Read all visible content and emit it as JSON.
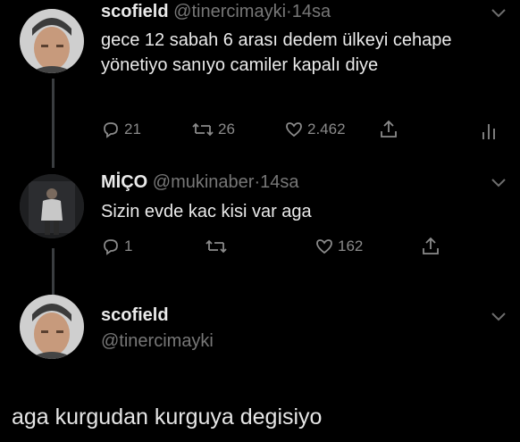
{
  "tweets": [
    {
      "name": "scofield",
      "handle": "@tinercimayki",
      "time": "14sa",
      "text": "gece 12 sabah 6 arası dedem ülkeyi cehape yönetiyo sanıyo camiler kapalı diye",
      "replies": "21",
      "retweets": "26",
      "likes": "2.462"
    },
    {
      "name": "MİÇO",
      "handle": "@mukinaber",
      "time": "14sa",
      "text": "Sizin evde kac kisi var aga",
      "replies": "1",
      "retweets": "",
      "likes": "162"
    }
  ],
  "account": {
    "name": "scofield",
    "handle": "@tinercimayki"
  },
  "caption": "aga kurgudan kurguya degisiyo",
  "separator": "·",
  "icons": [
    "reply-icon",
    "retweet-icon",
    "like-icon",
    "share-icon",
    "analytics-icon",
    "chevron-down-icon"
  ],
  "colors": {
    "background": "#000000",
    "text": "#eaeaea",
    "muted": "#8a8a8a",
    "thread_line": "#3a3d40"
  }
}
